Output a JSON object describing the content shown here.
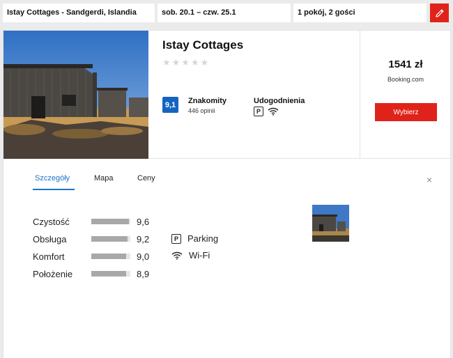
{
  "search": {
    "destination": "Istay Cottages - Sandgerdi, Islandia",
    "dates": "sob. 20.1  –  czw. 25.1",
    "guests": "1 pokój, 2 gości"
  },
  "hotel": {
    "name": "Istay Cottages",
    "stars": "★★★★★",
    "rating_score": "9,1",
    "rating_label": "Znakomity",
    "rating_count": "446 opinii",
    "amenities_title": "Udogodnienia",
    "price": "1541 zł",
    "provider": "Booking.com",
    "select_label": "Wybierz"
  },
  "details": {
    "tabs": [
      {
        "label": "Szczegóły",
        "active": true
      },
      {
        "label": "Mapa",
        "active": false
      },
      {
        "label": "Ceny",
        "active": false
      }
    ],
    "close_label": "×",
    "scores": [
      {
        "label": "Czystość",
        "value": "9,6",
        "fraction": 0.96
      },
      {
        "label": "Obsługa",
        "value": "9,2",
        "fraction": 0.92
      },
      {
        "label": "Komfort",
        "value": "9,0",
        "fraction": 0.9
      },
      {
        "label": "Położenie",
        "value": "8,9",
        "fraction": 0.89
      }
    ],
    "features": [
      {
        "icon": "parking-icon",
        "label": "Parking"
      },
      {
        "icon": "wifi-icon",
        "label": "Wi-Fi"
      }
    ]
  },
  "colors": {
    "accent_red": "#e0231a",
    "rating_blue": "#1565c0",
    "tab_active": "#1a73c8"
  }
}
